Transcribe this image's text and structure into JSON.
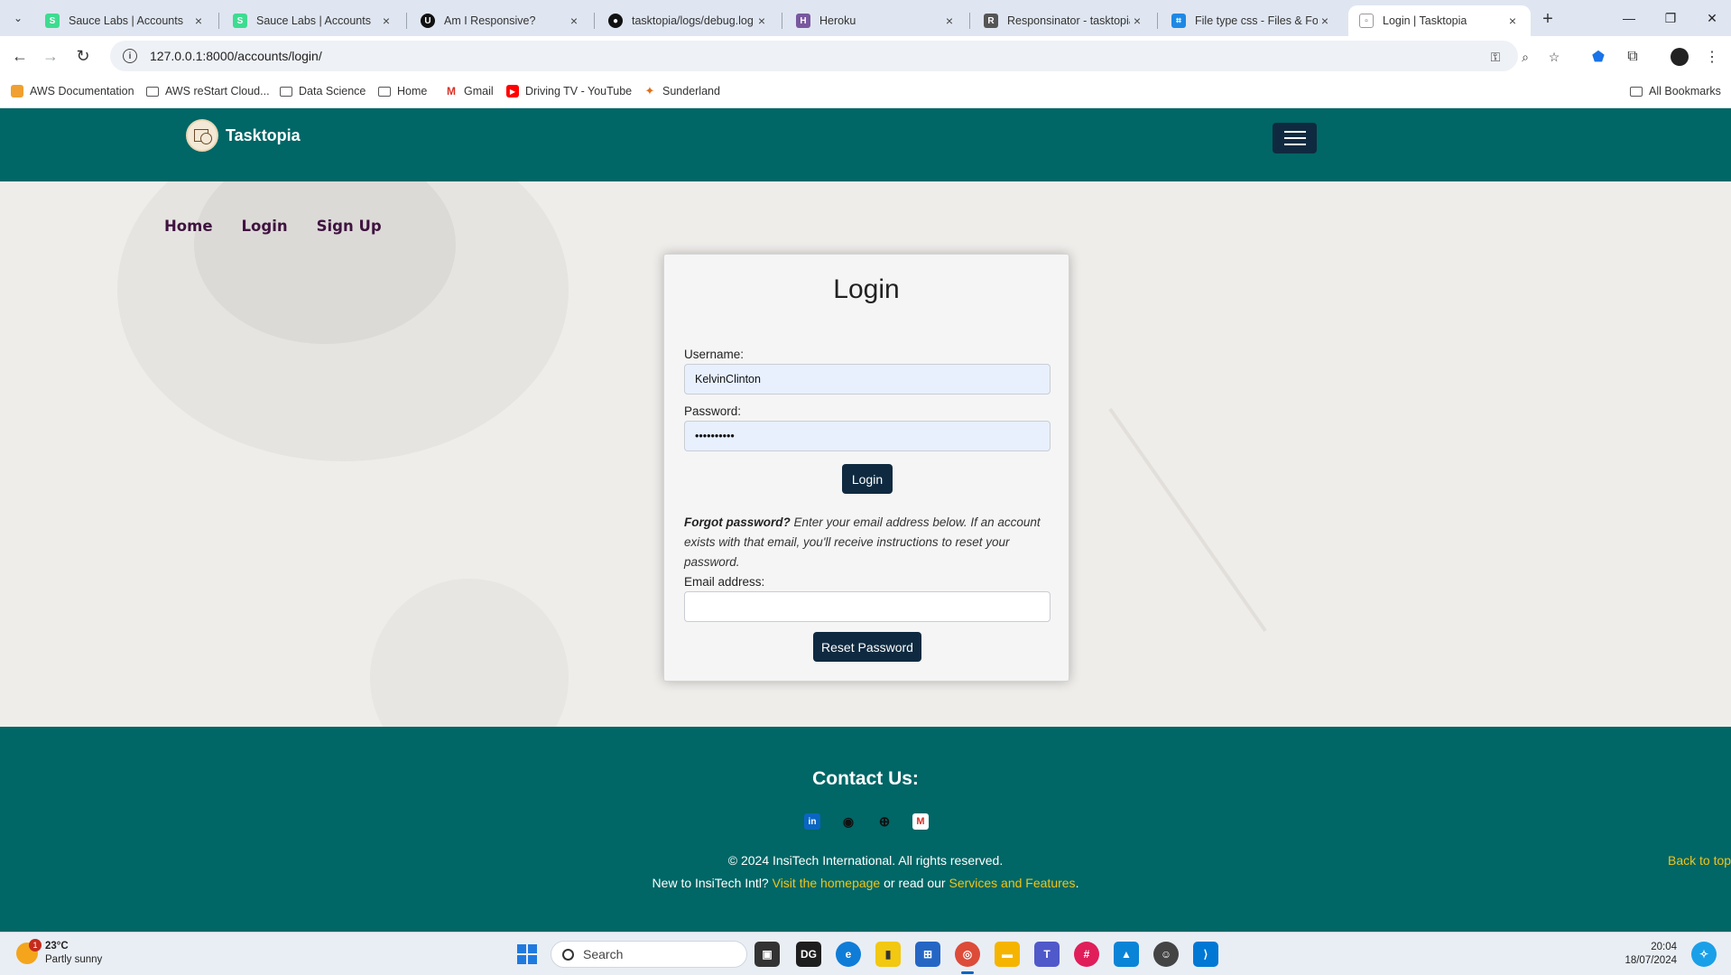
{
  "browser": {
    "tabs": [
      {
        "title": "Sauce Labs | Accounts",
        "icon": "sauce-labs-icon",
        "color": "#3ddc91"
      },
      {
        "title": "Sauce Labs | Accounts",
        "icon": "sauce-labs-icon",
        "color": "#3ddc91"
      },
      {
        "title": "Am I Responsive?",
        "icon": "amiresponsive-icon",
        "color": "#111111"
      },
      {
        "title": "tasktopia/logs/debug.log",
        "icon": "github-icon",
        "color": "#111111"
      },
      {
        "title": "Heroku",
        "icon": "heroku-icon",
        "color": "#79589f"
      },
      {
        "title": "Responsinator - tasktopia",
        "icon": "responsinator-icon",
        "color": "#555555"
      },
      {
        "title": "File type css - Files & Fold",
        "icon": "css-file-icon",
        "color": "#1e88e5"
      },
      {
        "title": "Login | Tasktopia",
        "icon": "page-icon",
        "color": "#888888"
      }
    ],
    "url": "127.0.0.1:8000/accounts/login/",
    "bookmarks": [
      {
        "label": "AWS Documentation"
      },
      {
        "label": "AWS reStart Cloud..."
      },
      {
        "label": "Data Science"
      },
      {
        "label": "Home"
      },
      {
        "label": "Gmail"
      },
      {
        "label": "Driving TV - YouTube"
      },
      {
        "label": "Sunderland"
      }
    ],
    "all_bookmarks": "All Bookmarks"
  },
  "site": {
    "brand": "Tasktopia",
    "nav_links": [
      "Home",
      "Login",
      "Sign Up"
    ],
    "theme_color": "#006666",
    "button_color": "#0f2a40",
    "link_color": "#3f1340"
  },
  "login": {
    "title": "Login",
    "username_label": "Username:",
    "username_value": "KelvinClinton",
    "password_label": "Password:",
    "password_value": "••••••••••",
    "login_button": "Login",
    "forgot_bold": "Forgot password?",
    "forgot_text": " Enter your email address below. If an account exists with that email, you'll receive instructions to reset your password.",
    "email_label": "Email address:",
    "email_value": "",
    "reset_button": "Reset Password"
  },
  "footer": {
    "heading": "Contact Us:",
    "socials": [
      "linkedin-icon",
      "github-icon",
      "globe-icon",
      "gmail-icon"
    ],
    "copyright": "© 2024 InsiTech International. All rights reserved.",
    "new_to": "New to InsiTech Intl?",
    "visit_link": "Visit the homepage",
    "or_read": " or read our ",
    "services_link": "Services and Features",
    "period": ".",
    "back_to_top": "Back to top"
  },
  "taskbar": {
    "temperature": "23°C",
    "weather": "Partly sunny",
    "weather_badge": "1",
    "search_placeholder": "Search",
    "time": "20:04",
    "date": "18/07/2024"
  }
}
